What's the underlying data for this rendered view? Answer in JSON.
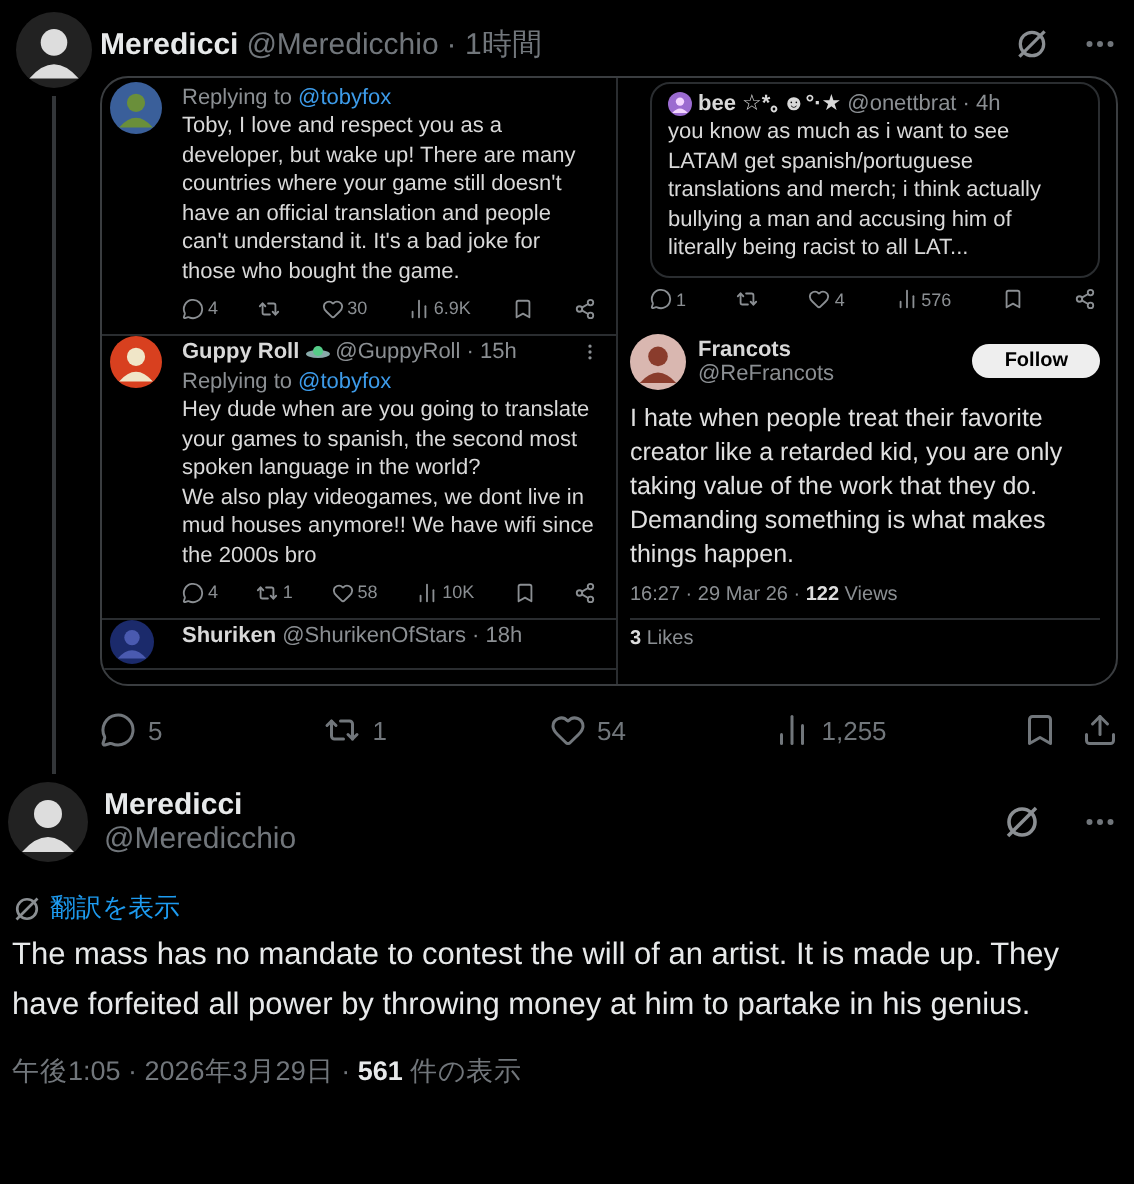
{
  "tweet": {
    "author": "Meredicci",
    "handle": "@Meredicchio",
    "time": "· 1時間",
    "screenshot": {
      "replies": [
        {
          "replying_label": "Replying to",
          "replying_handle": "@tobyfox",
          "text": "Toby, I love and respect you as a developer, but wake up! There are many countries where your game still doesn't have an official translation and people can't understand it. It's a bad joke for those who bought the game.",
          "stats": [
            {
              "kind": "reply",
              "count": "4"
            },
            {
              "kind": "repost"
            },
            {
              "kind": "like",
              "count": "30"
            },
            {
              "kind": "views",
              "count": "6.9K"
            }
          ]
        },
        {
          "name": "Guppy Roll",
          "handle": "@GuppyRoll · 15h",
          "replying_label": "Replying to",
          "replying_handle": "@tobyfox",
          "text": "Hey dude when are you going to translate your games to spanish, the second most spoken language in the world?\nWe also play videogames, we dont live in mud houses anymore!! We have wifi since the 2000s bro",
          "stats": [
            {
              "kind": "reply",
              "count": "4"
            },
            {
              "kind": "repost",
              "count": "1"
            },
            {
              "kind": "like",
              "count": "58"
            },
            {
              "kind": "views",
              "count": "10K"
            }
          ]
        }
      ],
      "cut_reply": {
        "name": "Shuriken",
        "handle": "@ShurikenOfStars · 18h"
      },
      "quote": {
        "name": "bee ☆*｡☻°·★",
        "handle": "@onettbrat · 4h",
        "text": "you know as much as i want to see LATAM get spanish/portuguese translations and merch; i think actually bullying a man and accusing him of literally being racist to all LAT..."
      },
      "quote_stats": [
        {
          "kind": "reply",
          "count": "1"
        },
        {
          "kind": "repost"
        },
        {
          "kind": "like",
          "count": "4"
        },
        {
          "kind": "views",
          "count": "576"
        }
      ],
      "post": {
        "name": "Francots",
        "handle": "@ReFrancots",
        "follow": "Follow",
        "text": "I hate when people treat their favorite creator like a retarded kid, you are only taking value of the work that they do. Demanding something is what makes things happen.",
        "time": "16:27 · 29 Mar 26 ·",
        "views_count": "122",
        "views_label": "Views",
        "likes_count": "3",
        "likes_label": "Likes"
      }
    },
    "actions": [
      {
        "kind": "reply",
        "count": "5"
      },
      {
        "kind": "repost",
        "count": "1"
      },
      {
        "kind": "like",
        "count": "54"
      },
      {
        "kind": "views",
        "count": "1,255"
      }
    ]
  },
  "reply": {
    "author": "Meredicci",
    "handle": "@Meredicchio",
    "translate": "翻訳を表示",
    "text": "The mass has no mandate to contest the will of an artist. It is made up. They have forfeited all power by throwing money at him to partake in his genius.",
    "time": "午後1:05 · 2026年3月29日 ·",
    "views": "561",
    "views_label": "件の表示"
  }
}
